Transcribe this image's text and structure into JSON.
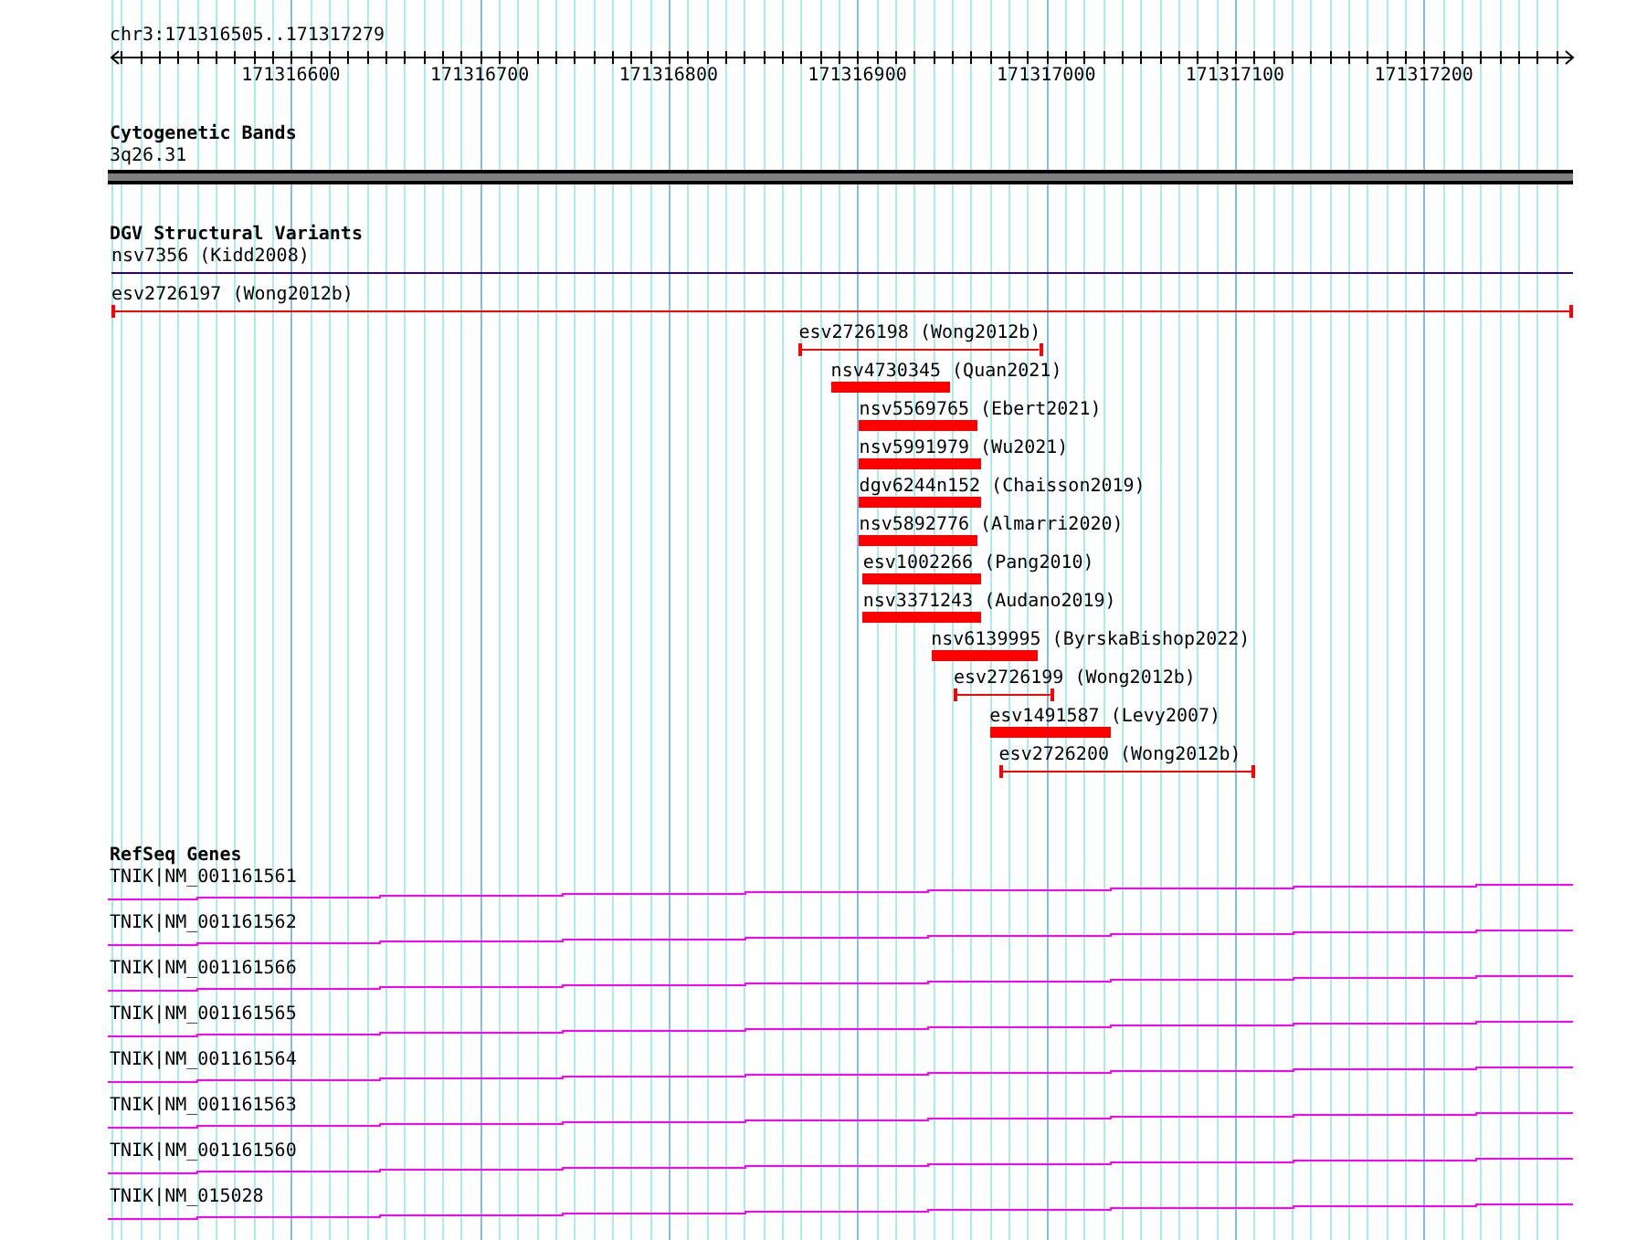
{
  "ruler": {
    "title": "chr3:171316505..171317279",
    "tick_labels": [
      "171316600",
      "171316700",
      "171316800",
      "171316900",
      "171317000",
      "171317100",
      "171317200"
    ]
  },
  "cytogenetic_bands": {
    "title": "Cytogenetic Bands",
    "band": "3q26.31"
  },
  "dgv_structural_variants": {
    "title": "DGV Structural Variants",
    "features": [
      {
        "label": "nsv7356 (Kidd2008)",
        "kind": "line",
        "color": "#330066"
      },
      {
        "label": "esv2726197 (Wong2012b)",
        "kind": "span",
        "color": "#ff0000"
      },
      {
        "label": "esv2726198 (Wong2012b)",
        "kind": "span",
        "color": "#ff0000"
      },
      {
        "label": "nsv4730345 (Quan2021)",
        "kind": "bar",
        "color": "#ff0000"
      },
      {
        "label": "nsv5569765 (Ebert2021)",
        "kind": "bar",
        "color": "#ff0000"
      },
      {
        "label": "nsv5991979 (Wu2021)",
        "kind": "bar",
        "color": "#ff0000"
      },
      {
        "label": "dgv6244n152 (Chaisson2019)",
        "kind": "bar",
        "color": "#ff0000"
      },
      {
        "label": "nsv5892776 (Almarri2020)",
        "kind": "bar",
        "color": "#ff0000"
      },
      {
        "label": "esv1002266 (Pang2010)",
        "kind": "bar",
        "color": "#ff0000"
      },
      {
        "label": "nsv3371243 (Audano2019)",
        "kind": "bar",
        "color": "#ff0000"
      },
      {
        "label": "nsv6139995 (ByrskaBishop2022)",
        "kind": "bar",
        "color": "#ff0000"
      },
      {
        "label": "esv2726199 (Wong2012b)",
        "kind": "span",
        "color": "#ff0000"
      },
      {
        "label": "esv1491587 (Levy2007)",
        "kind": "bar",
        "color": "#ff0000"
      },
      {
        "label": "esv2726200 (Wong2012b)",
        "kind": "span",
        "color": "#ff0000"
      }
    ]
  },
  "refseq_genes": {
    "title": "RefSeq Genes",
    "genes": [
      {
        "label": "TNIK|NM_001161561"
      },
      {
        "label": "TNIK|NM_001161562"
      },
      {
        "label": "TNIK|NM_001161566"
      },
      {
        "label": "TNIK|NM_001161565"
      },
      {
        "label": "TNIK|NM_001161564"
      },
      {
        "label": "TNIK|NM_001161563"
      },
      {
        "label": "TNIK|NM_001161560"
      },
      {
        "label": "TNIK|NM_015028"
      }
    ]
  }
}
